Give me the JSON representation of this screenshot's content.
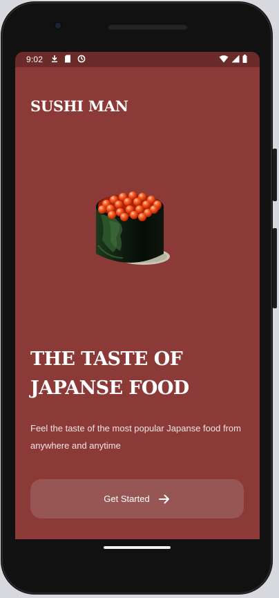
{
  "status_bar": {
    "time": "9:02",
    "left_icons": [
      "download-icon",
      "sd-card-icon",
      "sync-icon"
    ],
    "right_icons": [
      "wifi-icon",
      "cell-signal-icon",
      "battery-icon"
    ]
  },
  "brand": {
    "name": "SUSHI MAN"
  },
  "hero": {
    "image": "ikura-sushi-roll"
  },
  "headline": {
    "line1": "THE TASTE OF",
    "line2": "JAPANSE FOOD"
  },
  "subtitle": "Feel the taste of the most popular Japanse food from anywhere and anytime",
  "cta": {
    "label": "Get Started",
    "icon": "arrow-right-icon"
  },
  "colors": {
    "background": "#8b3a38",
    "status_bar": "#6a2b2a",
    "button": "#975654",
    "text": "#ffffff"
  }
}
